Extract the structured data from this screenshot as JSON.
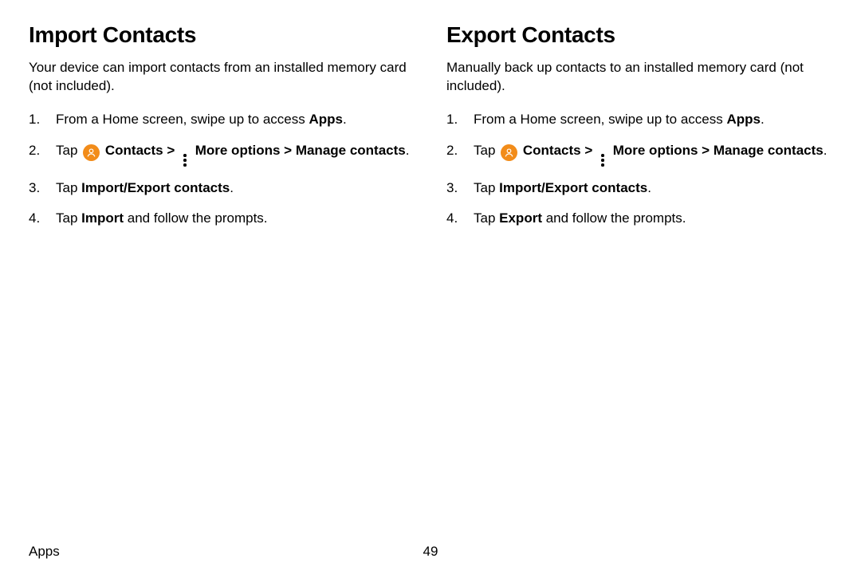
{
  "left": {
    "heading": "Import Contacts",
    "intro": "Your device can import contacts from an installed memory card (not included).",
    "step1_pre": "From a Home screen, swipe up to access ",
    "step1_bold": "Apps",
    "step1_post": ".",
    "step2_tap": "Tap ",
    "step2_contacts": "Contacts",
    "step2_arrow1": " > ",
    "step2_more": "More options",
    "step2_arrow2": " > ",
    "step2_manage": "Manage contacts",
    "step2_post": ".",
    "step3_pre": "Tap ",
    "step3_bold": "Import/Export contacts",
    "step3_post": ".",
    "step4_pre": "Tap ",
    "step4_bold": "Import",
    "step4_post": " and follow the prompts."
  },
  "right": {
    "heading": "Export Contacts",
    "intro": "Manually back up contacts to an installed memory card (not included).",
    "step1_pre": "From a Home screen, swipe up to access ",
    "step1_bold": "Apps",
    "step1_post": ".",
    "step2_tap": "Tap ",
    "step2_contacts": "Contacts",
    "step2_arrow1": " > ",
    "step2_more": "More options",
    "step2_arrow2": " > ",
    "step2_manage": "Manage contacts",
    "step2_post": ".",
    "step3_pre": "Tap ",
    "step3_bold": "Import/Export contacts",
    "step3_post": ".",
    "step4_pre": "Tap ",
    "step4_bold": "Export",
    "step4_post": " and follow the prompts."
  },
  "footer_label": "Apps",
  "page_number": "49"
}
